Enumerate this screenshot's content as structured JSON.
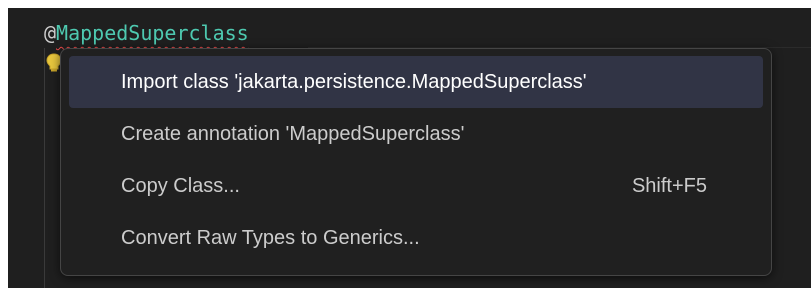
{
  "editor": {
    "code_line_at": "@",
    "code_line_annotation": "MappedSuperclass",
    "lightbulb_icon": "lightbulb-icon"
  },
  "quick_fix_menu": {
    "items": [
      {
        "label": "Import class 'jakarta.persistence.MappedSuperclass'",
        "shortcut": "",
        "selected": true
      },
      {
        "label": "Create annotation 'MappedSuperclass'",
        "shortcut": "",
        "selected": false
      },
      {
        "label": "Copy Class...",
        "shortcut": "Shift+F5",
        "selected": false
      },
      {
        "label": "Convert Raw Types to Generics...",
        "shortcut": "",
        "selected": false
      }
    ]
  },
  "colors": {
    "editor_background": "#1f1f1f",
    "annotation_type": "#4ec9b0",
    "error_squiggle": "#f14c4c",
    "menu_background": "#202020",
    "menu_selected_background": "#313445",
    "lightbulb": "#e8c73e"
  }
}
